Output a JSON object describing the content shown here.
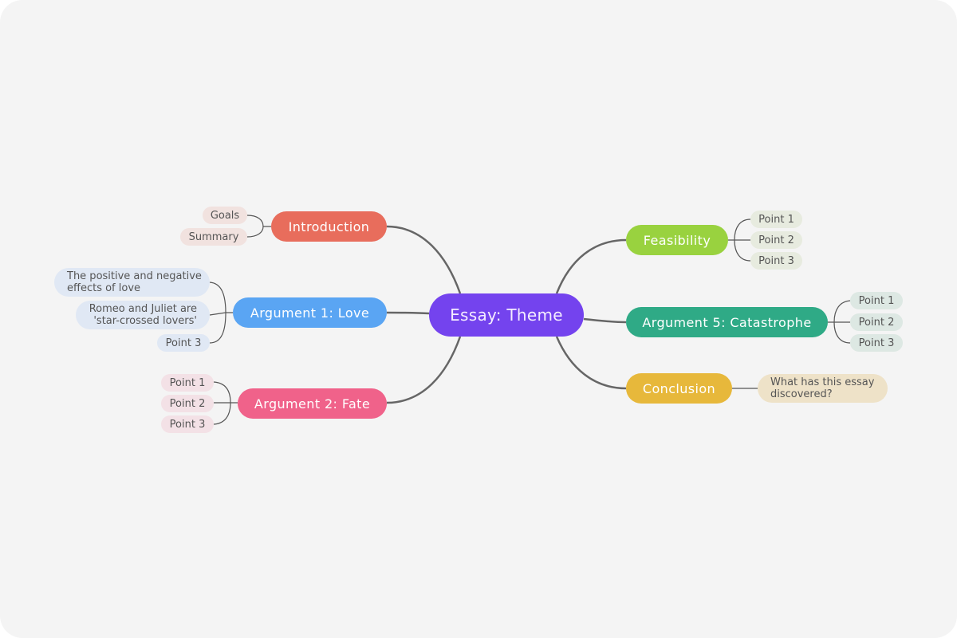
{
  "mindmap": {
    "root": {
      "label": "Essay: Theme",
      "color": "#7443ee"
    },
    "branches": [
      {
        "id": "introduction",
        "label": "Introduction",
        "side": "left",
        "color": "#e86d5c",
        "leaf_color": "#f1e2df",
        "children": [
          {
            "label": "Goals"
          },
          {
            "label": "Summary"
          }
        ]
      },
      {
        "id": "argument-1",
        "label": "Argument 1: Love",
        "side": "left",
        "color": "#5aa5f3",
        "leaf_color": "#e0e8f4",
        "children": [
          {
            "lines": [
              "The positive and negative",
              "effects of love"
            ]
          },
          {
            "lines": [
              "Romeo and Juliet are",
              "'star-crossed lovers'"
            ]
          },
          {
            "label": "Point 3"
          }
        ]
      },
      {
        "id": "argument-2",
        "label": "Argument 2: Fate",
        "side": "left",
        "color": "#f0628a",
        "leaf_color": "#f3e1e6",
        "children": [
          {
            "label": "Point 1"
          },
          {
            "label": "Point 2"
          },
          {
            "label": "Point 3"
          }
        ]
      },
      {
        "id": "feasibility",
        "label": "Feasibility",
        "side": "right",
        "color": "#99d23f",
        "leaf_color": "#e7ebdf",
        "children": [
          {
            "label": "Point 1"
          },
          {
            "label": "Point 2"
          },
          {
            "label": "Point 3"
          }
        ]
      },
      {
        "id": "argument-5",
        "label": "Argument 5: Catastrophe",
        "side": "right",
        "color": "#2faa86",
        "leaf_color": "#dde8e3",
        "children": [
          {
            "label": "Point 1"
          },
          {
            "label": "Point 2"
          },
          {
            "label": "Point 3"
          }
        ]
      },
      {
        "id": "conclusion",
        "label": "Conclusion",
        "side": "right",
        "color": "#e7b83b",
        "leaf_color": "#eee2c8",
        "children": [
          {
            "lines": [
              "What has this essay",
              "discovered?"
            ]
          }
        ]
      }
    ],
    "link_color": "#666666"
  }
}
